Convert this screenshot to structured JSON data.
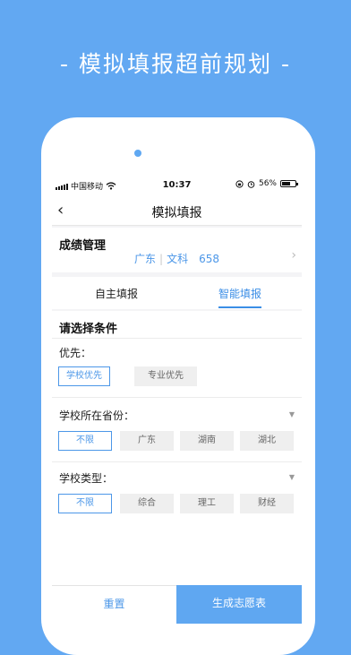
{
  "headline": "- 模拟填报超前规划 -",
  "statusbar": {
    "carrier": "中国移动",
    "time": "10:37",
    "battery": "56%",
    "wifi_icon": "wifi-icon",
    "alarm_icon": "alarm-icon",
    "lock_icon": "rotation-lock-icon"
  },
  "navbar": {
    "back": "‹",
    "title": "模拟填报"
  },
  "score": {
    "label": "成绩管理",
    "province": "广东",
    "subject": "文科",
    "value": "658",
    "chevron": "›"
  },
  "tabs": [
    {
      "label": "自主填报"
    },
    {
      "label": "智能填报",
      "active": true
    }
  ],
  "filters": {
    "heading": "请选择条件",
    "priority": {
      "label": "优先：",
      "options": [
        "学校优先",
        "专业优先"
      ],
      "selected": "学校优先"
    },
    "province": {
      "label": "学校所在省份：",
      "options": [
        "不限",
        "广东",
        "湖南",
        "湖北"
      ],
      "selected": "不限"
    },
    "type": {
      "label": "学校类型：",
      "options": [
        "不限",
        "综合",
        "理工",
        "财经"
      ],
      "selected": "不限"
    }
  },
  "buttons": {
    "reset": "重置",
    "generate": "生成志愿表"
  },
  "colors": {
    "background": "#62a8f2",
    "accent": "#4c97e8",
    "button": "#5fa7f1"
  }
}
